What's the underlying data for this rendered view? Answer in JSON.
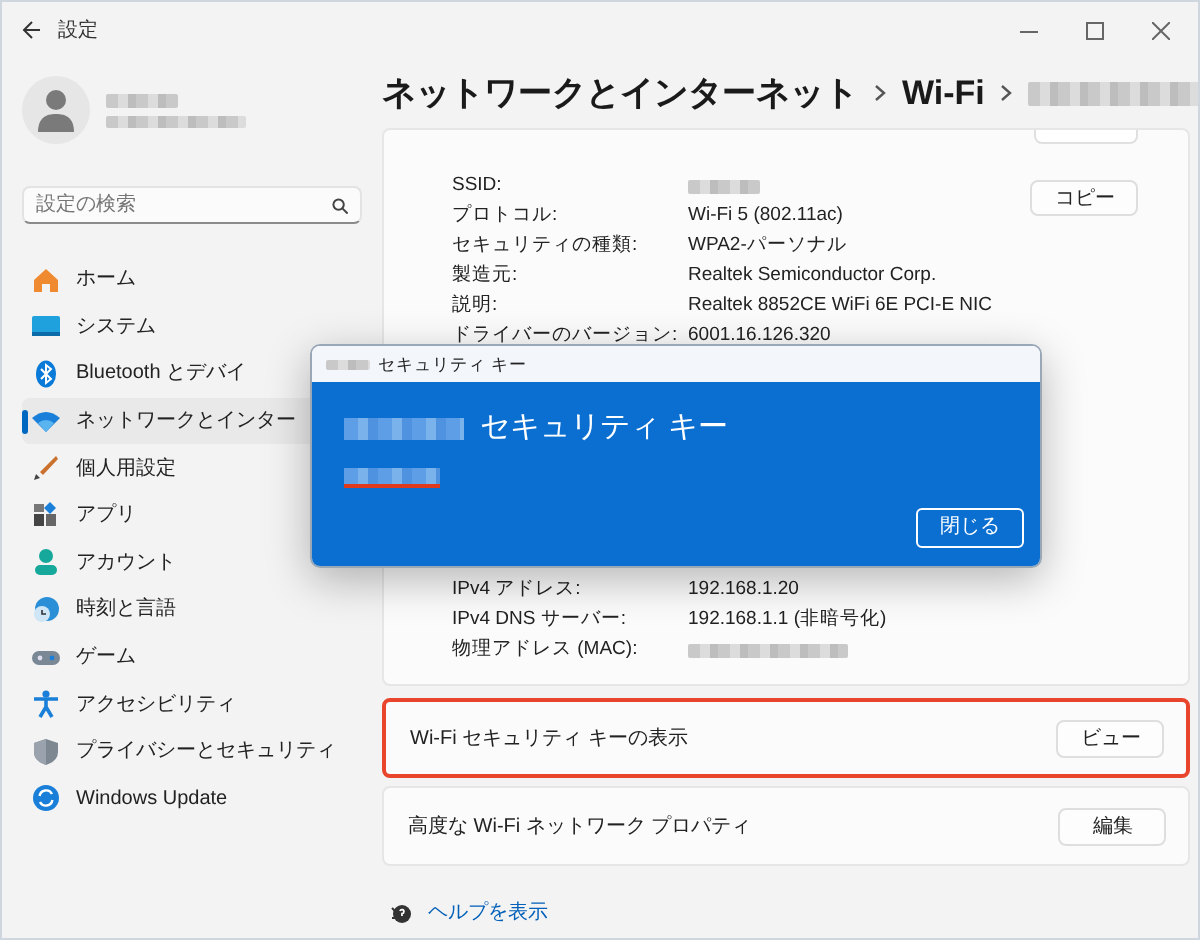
{
  "window": {
    "title": "設定"
  },
  "sidebar": {
    "search": {
      "placeholder": "設定の検索"
    },
    "items": [
      {
        "label": "ホーム",
        "selected": false
      },
      {
        "label": "システム",
        "selected": false
      },
      {
        "label": "Bluetooth とデバイ",
        "selected": false
      },
      {
        "label": "ネットワークとインター",
        "selected": true
      },
      {
        "label": "個人用設定",
        "selected": false
      },
      {
        "label": "アプリ",
        "selected": false
      },
      {
        "label": "アカウント",
        "selected": false
      },
      {
        "label": "時刻と言語",
        "selected": false
      },
      {
        "label": "ゲーム",
        "selected": false
      },
      {
        "label": "アクセシビリティ",
        "selected": false
      },
      {
        "label": "プライバシーとセキュリティ",
        "selected": false
      },
      {
        "label": "Windows Update",
        "selected": false
      }
    ]
  },
  "breadcrumb": [
    "ネットワークとインターネット",
    "Wi-Fi"
  ],
  "properties": [
    {
      "label": "SSID:"
    },
    {
      "label": "プロトコル:",
      "value": "Wi-Fi 5 (802.11ac)"
    },
    {
      "label": "セキュリティの種類:",
      "value": "WPA2-パーソナル"
    },
    {
      "label": "製造元:",
      "value": "Realtek Semiconductor Corp."
    },
    {
      "label": "説明:",
      "value": "Realtek 8852CE WiFi 6E PCI-E NIC"
    },
    {
      "label": "ドライバーのバージョン:",
      "value": "6001.16.126.320"
    }
  ],
  "more_properties": [
    {
      "label": "IPv4 アドレス:",
      "value": "192.168.1.20"
    },
    {
      "label": "IPv4 DNS サーバー:",
      "value": "192.168.1.1 (非暗号化)"
    },
    {
      "label": "物理アドレス (MAC):"
    }
  ],
  "copy_button": "コピー",
  "settings_rows": [
    {
      "label": "Wi-Fi セキュリティ キーの表示",
      "button": "ビュー",
      "highlighted": true
    },
    {
      "label": "高度な Wi-Fi ネットワーク プロパティ",
      "button": "編集",
      "highlighted": false
    }
  ],
  "help_link": "ヘルプを表示",
  "dialog": {
    "title": "セキュリティ キー",
    "heading": "セキュリティ キー",
    "close_button": "閉じる"
  }
}
